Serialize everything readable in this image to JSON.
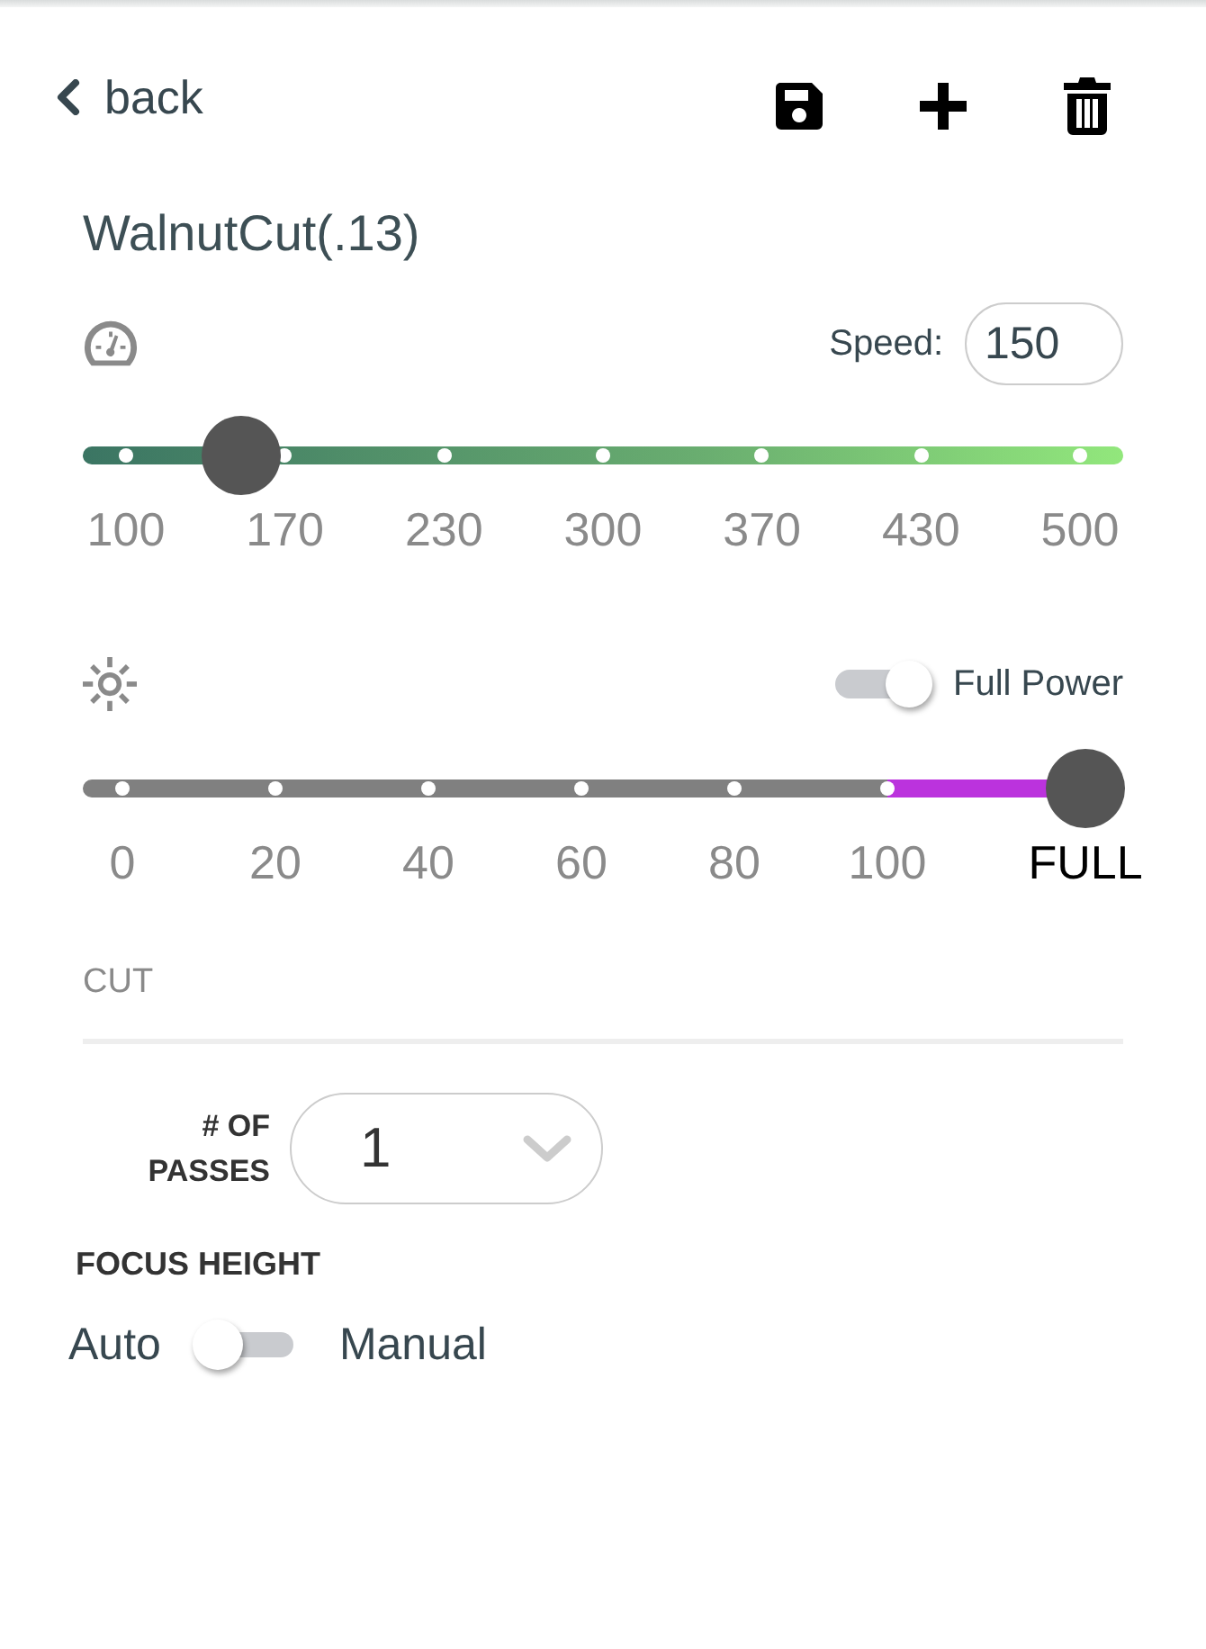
{
  "header": {
    "back": {
      "label": "back"
    }
  },
  "title": "WalnutCut(.13)",
  "speed": {
    "label": "Speed:",
    "value": "150",
    "level": 0.152,
    "ticks": [
      "100",
      "170",
      "230",
      "300",
      "370",
      "430",
      "500"
    ]
  },
  "power": {
    "toggle": {
      "label": "Full Power",
      "on": true
    },
    "level": 0.964,
    "ticks": [
      {
        "label": "0",
        "kind": "number"
      },
      {
        "label": "20",
        "kind": "number"
      },
      {
        "label": "40",
        "kind": "number"
      },
      {
        "label": "60",
        "kind": "number"
      },
      {
        "label": "80",
        "kind": "number"
      },
      {
        "label": "100",
        "kind": "number"
      },
      {
        "label": "FULL",
        "kind": "full"
      }
    ]
  },
  "cut": {
    "heading": "CUT",
    "passes": {
      "label": "# OF PASSES",
      "value": "1"
    },
    "focus_height": {
      "heading": "FOCUS HEIGHT",
      "off_label": "Auto",
      "on_label": "Manual",
      "on": false
    }
  }
}
